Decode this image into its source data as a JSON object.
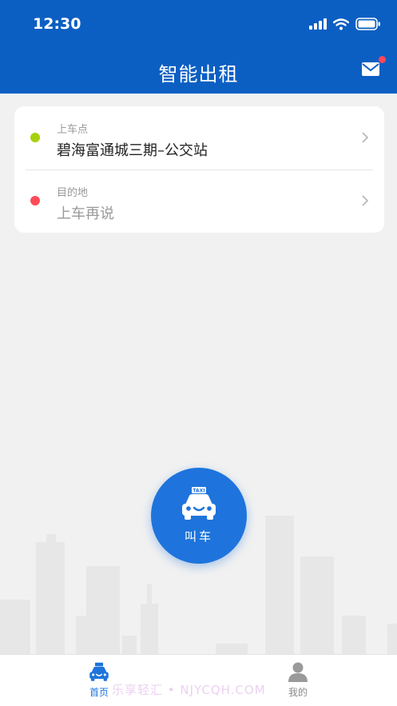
{
  "status_bar": {
    "time": "12:30"
  },
  "header": {
    "title": "智能出租"
  },
  "trip": {
    "pickup": {
      "label": "上车点",
      "value": "碧海富通城三期–公交站"
    },
    "destination": {
      "label": "目的地",
      "value": "上车再说"
    }
  },
  "call_button": {
    "label": "叫车",
    "icon_text": "TAXI"
  },
  "tabs": [
    {
      "label": "首页",
      "icon": "taxi-icon",
      "active": true
    },
    {
      "label": "我的",
      "icon": "user-icon",
      "active": false
    }
  ],
  "watermark": "乐享轻汇 • NJYCQH.COM",
  "colors": {
    "primary": "#0b5fc3",
    "accent": "#1e74dc",
    "pickup_dot": "#a6d10f",
    "destination_dot": "#ff4b55",
    "badge": "#ff4757"
  }
}
